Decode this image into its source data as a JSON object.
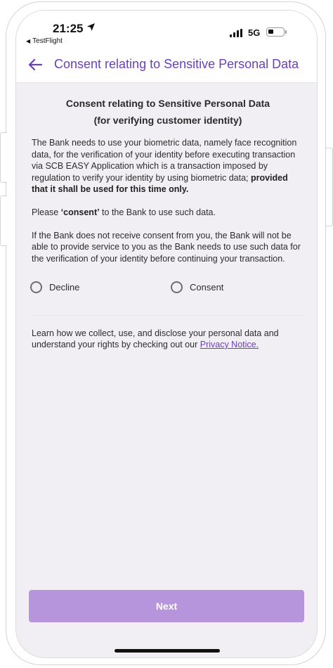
{
  "status_bar": {
    "time": "21:25",
    "back_app": "TestFlight",
    "network": "5G"
  },
  "header": {
    "title": "Consent relating to Sensitive Personal Data"
  },
  "content": {
    "title_line1": "Consent relating to Sensitive Personal Data",
    "title_line2": "(for verifying customer identity)",
    "para1_text": "The Bank needs to use your biometric data, namely face recognition data, for the verification of your identity before executing transaction via SCB EASY Application which is a transaction imposed by regulation to verify your identity by using biometric data; ",
    "para1_bold": "provided that it shall be used for this time only.",
    "para2_prefix": "Please ",
    "para2_bold": "‘consent’",
    "para2_suffix": " to the Bank to use such data.",
    "para3": "If the Bank does not receive consent from you, the Bank will not be able to provide service to you as the Bank needs to use such data for the verification of your identity before continuing your transaction.",
    "options": [
      {
        "label": "Decline",
        "selected": false
      },
      {
        "label": "Consent",
        "selected": false
      }
    ],
    "notice_text": "Learn how we collect, use, and disclose your personal data and understand your rights by checking out our ",
    "notice_link": "Privacy Notice."
  },
  "footer": {
    "next_label": "Next",
    "next_disabled": true
  },
  "colors": {
    "accent": "#6a3fbf",
    "button_disabled": "#b795dd",
    "background": "#f1eff4"
  }
}
